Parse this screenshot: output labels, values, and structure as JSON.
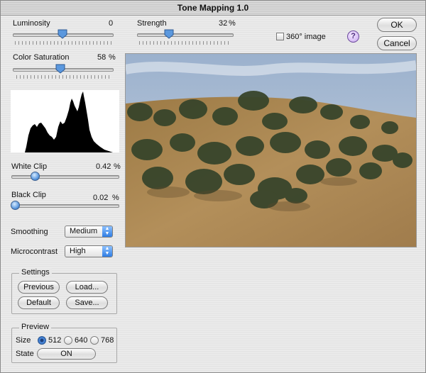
{
  "window": {
    "title": "Tone Mapping 1.0"
  },
  "sliders": {
    "luminosity": {
      "label": "Luminosity",
      "value": "0",
      "unit": "",
      "fraction": 0.5
    },
    "strength": {
      "label": "Strength",
      "value": "32",
      "unit": "%",
      "fraction": 0.32
    },
    "color_saturation": {
      "label": "Color Saturation",
      "value": "58",
      "unit": "%",
      "fraction": 0.5
    },
    "white_clip": {
      "label": "White Clip",
      "value": "0.42",
      "unit": "%",
      "fraction": 0.21
    },
    "black_clip": {
      "label": "Black Clip",
      "value": "0.02",
      "unit": "%",
      "fraction": 0.01
    }
  },
  "options": {
    "image_360_label": "360° image",
    "image_360_checked": false
  },
  "buttons": {
    "ok": "OK",
    "cancel": "Cancel"
  },
  "help": {
    "symbol": "?"
  },
  "selects": {
    "smoothing": {
      "label": "Smoothing",
      "value": "Medium"
    },
    "microcontrast": {
      "label": "Microcontrast",
      "value": "High"
    }
  },
  "settings": {
    "title": "Settings",
    "previous": "Previous",
    "load": "Load...",
    "default": "Default",
    "save": "Save..."
  },
  "preview": {
    "title": "Preview",
    "size_label": "Size",
    "sizes": [
      {
        "label": "512",
        "selected": true
      },
      {
        "label": "640",
        "selected": false
      },
      {
        "label": "768",
        "selected": false
      }
    ],
    "state_label": "State",
    "state_button": "ON"
  },
  "colors": {
    "accent": "#2f7de3",
    "sky": "#8fa8c8",
    "hill": "#a7834d",
    "trees": "#3d4a2c"
  }
}
